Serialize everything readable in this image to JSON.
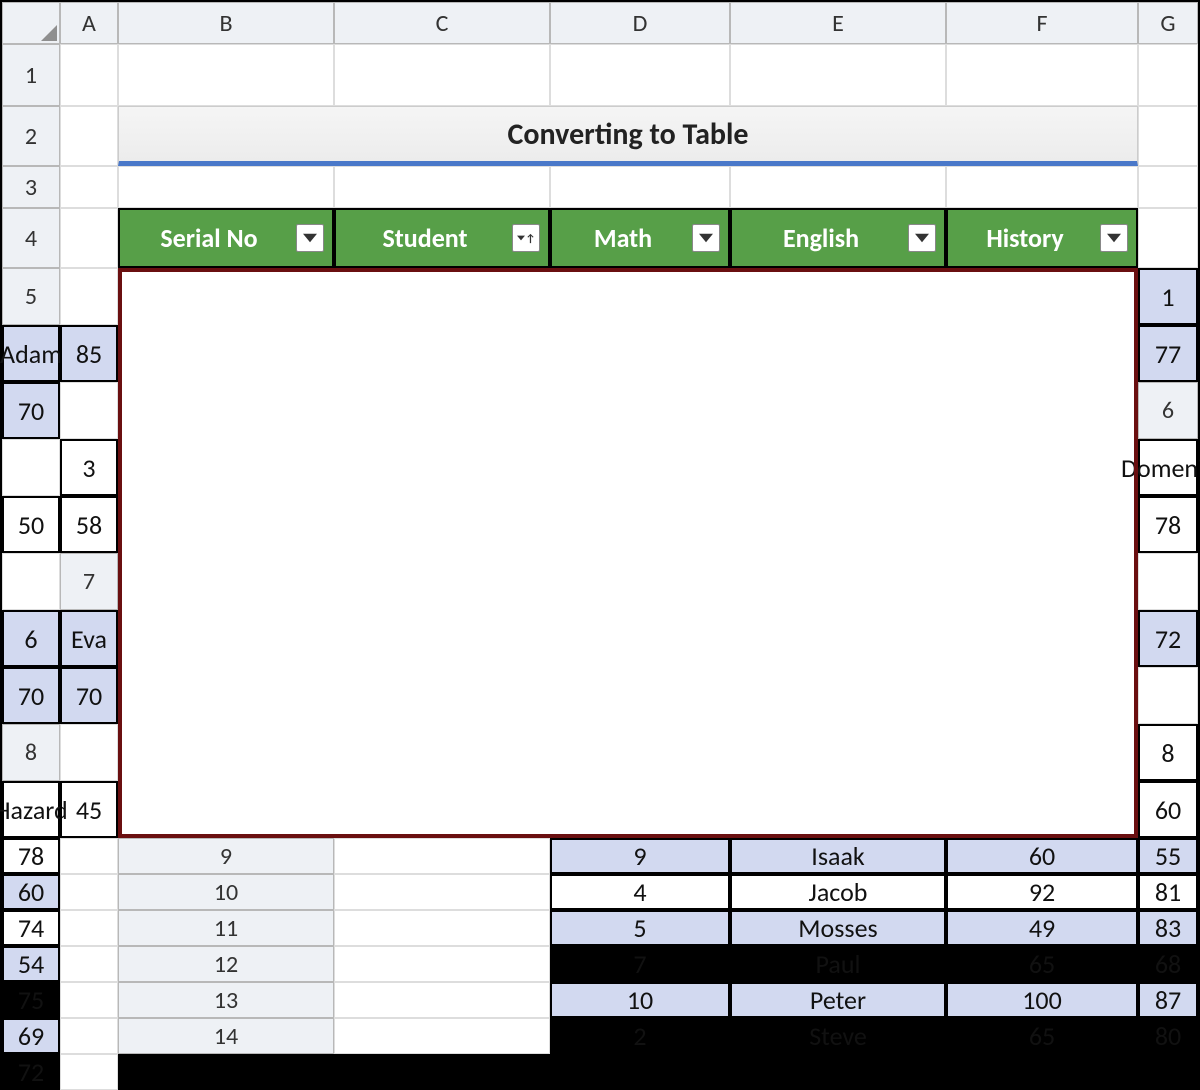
{
  "title": "Converting to Table",
  "columns_letters": [
    "A",
    "B",
    "C",
    "D",
    "E",
    "F",
    "G"
  ],
  "row_numbers": [
    "1",
    "2",
    "3",
    "4",
    "5",
    "6",
    "7",
    "8",
    "9",
    "10",
    "11",
    "12",
    "13",
    "14"
  ],
  "table": {
    "headers": [
      {
        "label": "Serial No",
        "sorted": false
      },
      {
        "label": "Student",
        "sorted": true
      },
      {
        "label": "Math",
        "sorted": false
      },
      {
        "label": "English",
        "sorted": false
      },
      {
        "label": "History",
        "sorted": false
      }
    ],
    "rows": [
      [
        "1",
        "Adam",
        "85",
        "77",
        "70"
      ],
      [
        "3",
        "Domenic",
        "50",
        "58",
        "78"
      ],
      [
        "6",
        "Eva",
        "72",
        "70",
        "70"
      ],
      [
        "8",
        "Hazard",
        "45",
        "60",
        "78"
      ],
      [
        "9",
        "Isaak",
        "60",
        "55",
        "60"
      ],
      [
        "4",
        "Jacob",
        "92",
        "81",
        "74"
      ],
      [
        "5",
        "Mosses",
        "49",
        "83",
        "54"
      ],
      [
        "7",
        "Paul",
        "65",
        "68",
        "75"
      ],
      [
        "10",
        "Peter",
        "100",
        "87",
        "69"
      ],
      [
        "2",
        "Steve",
        "65",
        "80",
        "72"
      ]
    ]
  }
}
